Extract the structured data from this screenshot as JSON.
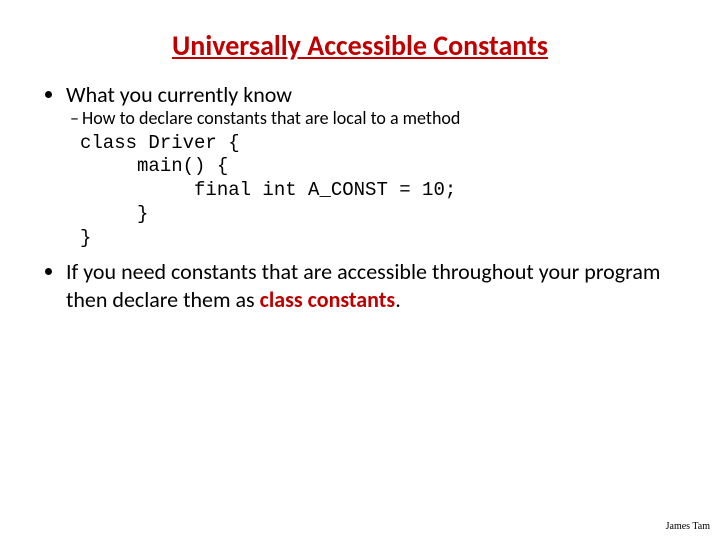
{
  "title": "Universally Accessible Constants",
  "bullet1": "What you currently know",
  "sub1": "How to declare constants that are local to a method",
  "code": "class Driver {\n     main() {\n          final int A_CONST = 10;\n     }\n}",
  "bullet2_a": "If you need constants that are accessible throughout your program then declare them as ",
  "bullet2_b": "class constants",
  "bullet2_c": ".",
  "footer": "James Tam",
  "dash": "–"
}
